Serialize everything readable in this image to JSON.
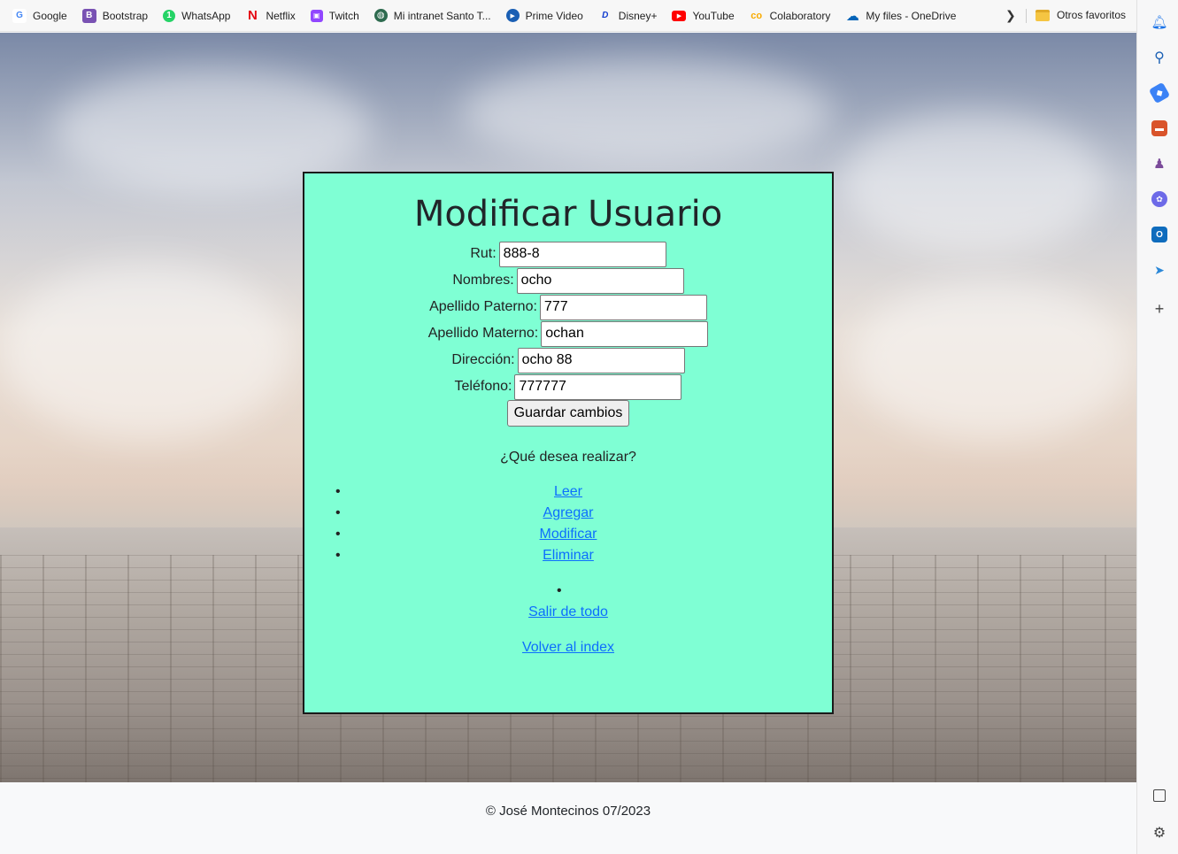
{
  "bookmarks": [
    {
      "label": "Google",
      "icon": "google-icon",
      "color": "#4285f4",
      "glyph": "G"
    },
    {
      "label": "Bootstrap",
      "icon": "bootstrap-icon",
      "color": "#7952b3",
      "glyph": "B"
    },
    {
      "label": "WhatsApp",
      "icon": "whatsapp-icon",
      "color": "#25d366",
      "glyph": "1"
    },
    {
      "label": "Netflix",
      "icon": "netflix-icon",
      "color": "#e50914",
      "glyph": "N"
    },
    {
      "label": "Twitch",
      "icon": "twitch-icon",
      "color": "#9146ff",
      "glyph": "▣"
    },
    {
      "label": "Mi intranet Santo T...",
      "icon": "intranet-icon",
      "color": "#2e6b4f",
      "glyph": "◍"
    },
    {
      "label": "Prime Video",
      "icon": "prime-video-icon",
      "color": "#1a5fb4",
      "glyph": "▶"
    },
    {
      "label": "Disney+",
      "icon": "disney-icon",
      "color": "#113ccf",
      "glyph": "D"
    },
    {
      "label": "YouTube",
      "icon": "youtube-icon",
      "color": "#ff0000",
      "glyph": "▶"
    },
    {
      "label": "Colaboratory",
      "icon": "colab-icon",
      "color": "#f9ab00",
      "glyph": "co"
    },
    {
      "label": "My files - OneDrive",
      "icon": "onedrive-icon",
      "color": "#0364b8",
      "glyph": "☁"
    }
  ],
  "bookmarks_more": "Otros favoritos",
  "form": {
    "title": "Modificar Usuario",
    "fields": [
      {
        "label": "Rut:",
        "value": "888-8"
      },
      {
        "label": "Nombres:",
        "value": "ocho"
      },
      {
        "label": "Apellido Paterno:",
        "value": "777"
      },
      {
        "label": "Apellido Materno:",
        "value": "ochan"
      },
      {
        "label": "Dirección:",
        "value": "ocho 88"
      },
      {
        "label": "Teléfono:",
        "value": "777777"
      }
    ],
    "submit_label": "Guardar cambios"
  },
  "menu": {
    "question": "¿Qué desea realizar?",
    "options": [
      "Leer",
      "Agregar",
      "Modificar",
      "Eliminar"
    ],
    "exit_label": "Salir de todo",
    "back_label": "Volver al index"
  },
  "footer": {
    "text": "© José Montecinos 07/2023"
  },
  "colors": {
    "card": "#7fffd4",
    "link": "#0d6efd"
  }
}
